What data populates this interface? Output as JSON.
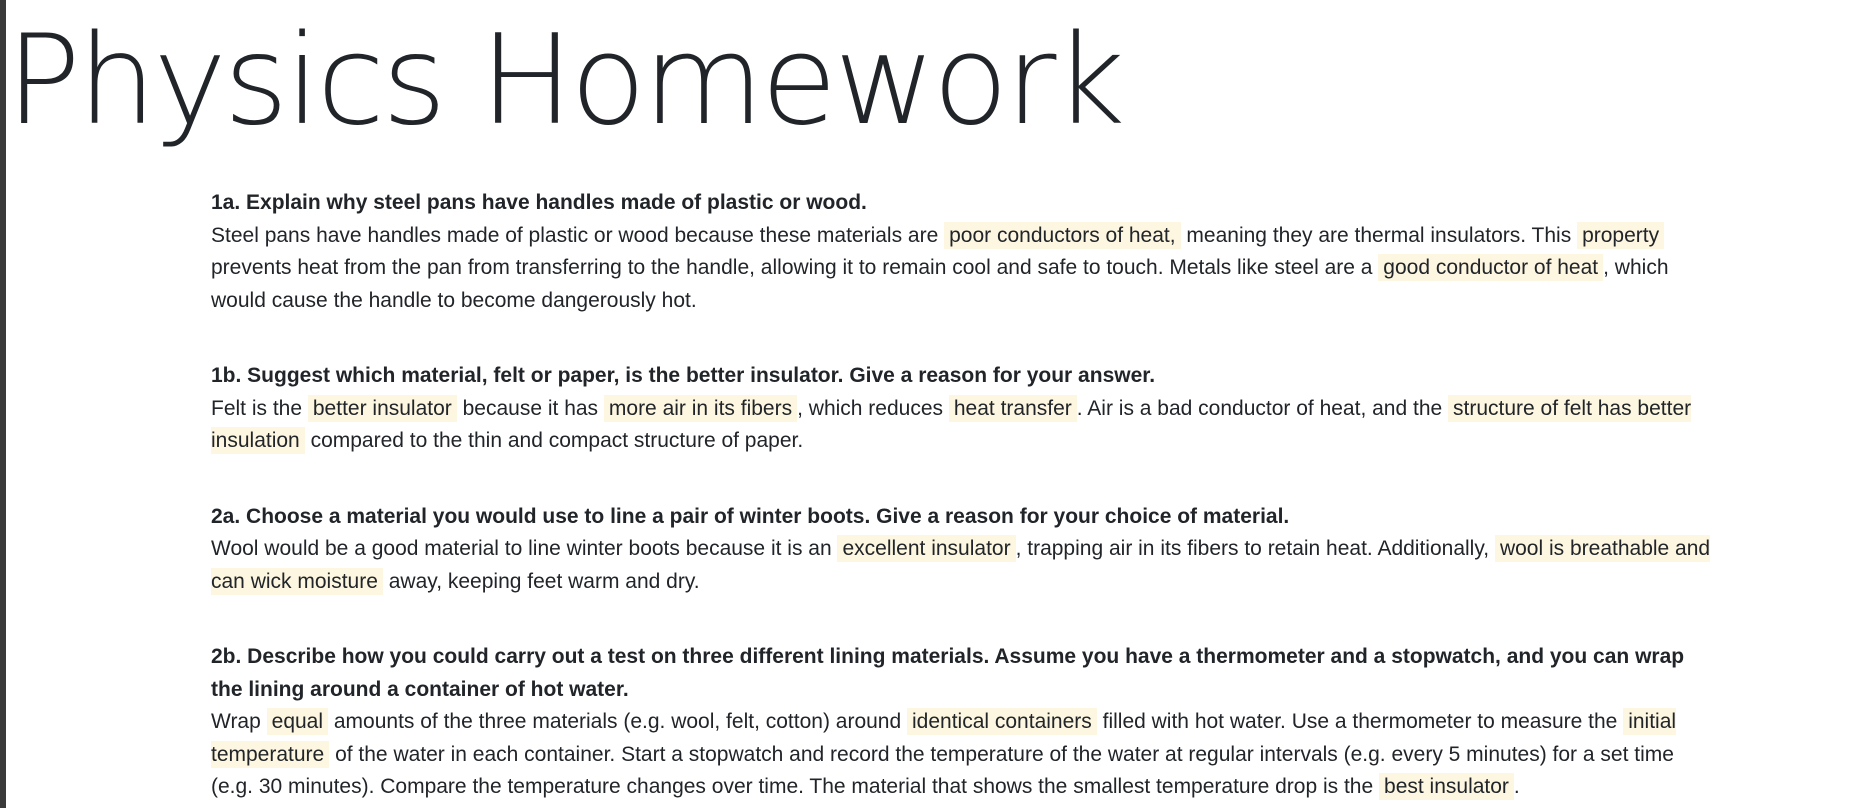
{
  "page": {
    "title": "Physics Homework"
  },
  "colors": {
    "highlight": "#fdf6e0",
    "text": "#212529",
    "left_bar": "#3a3a3a"
  },
  "questions": [
    {
      "id": "1a",
      "question": "1a. Explain why steel pans have handles made of plastic or wood.",
      "answer_segments": [
        {
          "text": "Steel pans have handles made of plastic or wood because these materials are ",
          "highlight": false
        },
        {
          "text": "poor conductors of heat,",
          "highlight": true
        },
        {
          "text": " meaning they are thermal insulators. This ",
          "highlight": false
        },
        {
          "text": "property",
          "highlight": true
        },
        {
          "text": " prevents heat from the pan from transferring to the handle, allowing it to remain cool and safe to touch. Metals like steel are a ",
          "highlight": false
        },
        {
          "text": "good conductor of heat",
          "highlight": true
        },
        {
          "text": ", which would cause the handle to become dangerously hot.",
          "highlight": false
        }
      ]
    },
    {
      "id": "1b",
      "question": "1b. Suggest which material, felt or paper, is the better insulator. Give a reason for your answer.",
      "answer_segments": [
        {
          "text": "Felt is the ",
          "highlight": false
        },
        {
          "text": "better insulator",
          "highlight": true
        },
        {
          "text": " because it has ",
          "highlight": false
        },
        {
          "text": "more air in its fibers",
          "highlight": true
        },
        {
          "text": ", which reduces ",
          "highlight": false
        },
        {
          "text": "heat transfer",
          "highlight": true
        },
        {
          "text": ". Air is a bad conductor of heat, and the ",
          "highlight": false
        },
        {
          "text": "structure of felt has better insulation",
          "highlight": true
        },
        {
          "text": " compared to the thin and compact structure of paper.",
          "highlight": false
        }
      ]
    },
    {
      "id": "2a",
      "question": "2a. Choose a material you would use to line a pair of winter boots. Give a reason for your choice of material.",
      "answer_segments": [
        {
          "text": "Wool would be a good material to line winter boots because it is an ",
          "highlight": false
        },
        {
          "text": "excellent insulator",
          "highlight": true
        },
        {
          "text": ", trapping air in its fibers to retain heat. Additionally, ",
          "highlight": false
        },
        {
          "text": "wool is breathable and can wick moisture",
          "highlight": true
        },
        {
          "text": " away, keeping feet warm and dry.",
          "highlight": false
        }
      ]
    },
    {
      "id": "2b",
      "question": "2b. Describe how you could carry out a test on three different lining materials. Assume you have a thermometer and a stopwatch, and you can wrap the lining around a container of hot water.",
      "answer_segments": [
        {
          "text": "Wrap ",
          "highlight": false
        },
        {
          "text": "equal",
          "highlight": true
        },
        {
          "text": " amounts of the three materials (e.g. wool, felt, cotton) around ",
          "highlight": false
        },
        {
          "text": "identical containers",
          "highlight": true
        },
        {
          "text": " filled with hot water. Use a thermometer to measure the ",
          "highlight": false
        },
        {
          "text": "initial temperature",
          "highlight": true
        },
        {
          "text": " of the water in each container. Start a stopwatch and record the temperature of the water at regular intervals (e.g. every 5 minutes) for a set time (e.g. 30 minutes). Compare the temperature changes over time. The material that shows the smallest temperature drop is the ",
          "highlight": false
        },
        {
          "text": "best insulator",
          "highlight": true
        },
        {
          "text": ".",
          "highlight": false
        }
      ]
    }
  ]
}
